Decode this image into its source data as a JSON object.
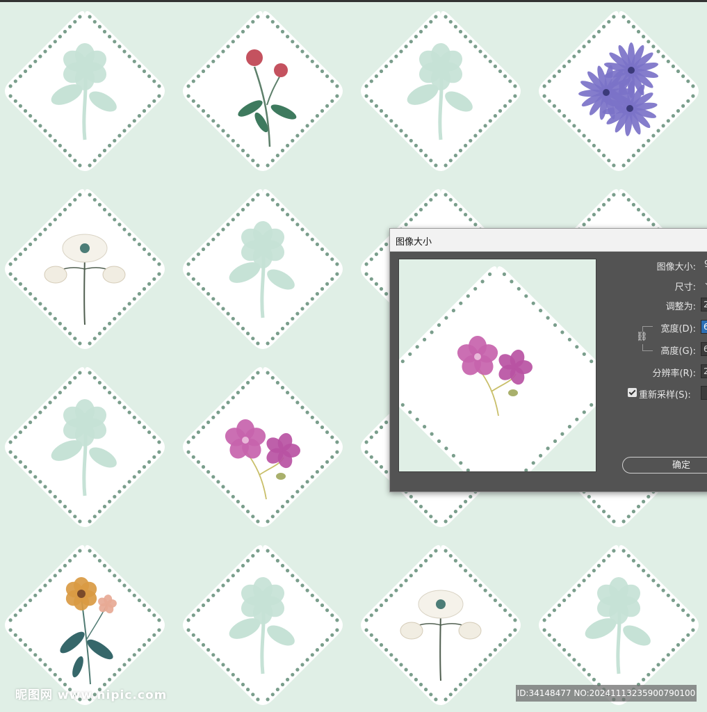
{
  "canvas": {
    "background": "#e0efe6",
    "dot_color": "#7a9e8c",
    "tiles": [
      {
        "kind": "silhouette",
        "name": "poppy-silhouette"
      },
      {
        "kind": "clover",
        "name": "red-clover"
      },
      {
        "kind": "silhouette",
        "name": "wildflower-silhouette"
      },
      {
        "kind": "chicory",
        "name": "purple-chicory"
      },
      {
        "kind": "poppy-white",
        "name": "white-poppy"
      },
      {
        "kind": "silhouette",
        "name": "yarrow-silhouette"
      },
      {
        "kind": "hidden",
        "name": "tile-behind-dialog"
      },
      {
        "kind": "hidden",
        "name": "tile-behind-dialog"
      },
      {
        "kind": "silhouette",
        "name": "rose-silhouette"
      },
      {
        "kind": "geranium",
        "name": "pink-geranium"
      },
      {
        "kind": "hidden",
        "name": "tile-behind-dialog"
      },
      {
        "kind": "hidden",
        "name": "tile-behind-dialog"
      },
      {
        "kind": "orange-flower",
        "name": "orange-flower"
      },
      {
        "kind": "silhouette",
        "name": "anemone-silhouette"
      },
      {
        "kind": "poppy-white",
        "name": "white-poppy-2"
      },
      {
        "kind": "silhouette",
        "name": "plant-silhouette"
      }
    ]
  },
  "dialog": {
    "title": "图像大小",
    "labels": {
      "image_size": "图像大小:",
      "dimensions": "尺寸:",
      "fit_to": "调整为:",
      "width": "宽度(D):",
      "height": "高度(G):",
      "resolution": "分辨率(R):",
      "resample": "重新采样(S):"
    },
    "values": {
      "image_size": "9",
      "width": "6",
      "height": "6",
      "fit_to": "2",
      "resolution": "2"
    },
    "resample_checked": true,
    "ok_label": "确定"
  },
  "watermark": {
    "left": "昵图网 www.nipic.com",
    "right": "ID:34148477 NO:20241113235900790100"
  }
}
